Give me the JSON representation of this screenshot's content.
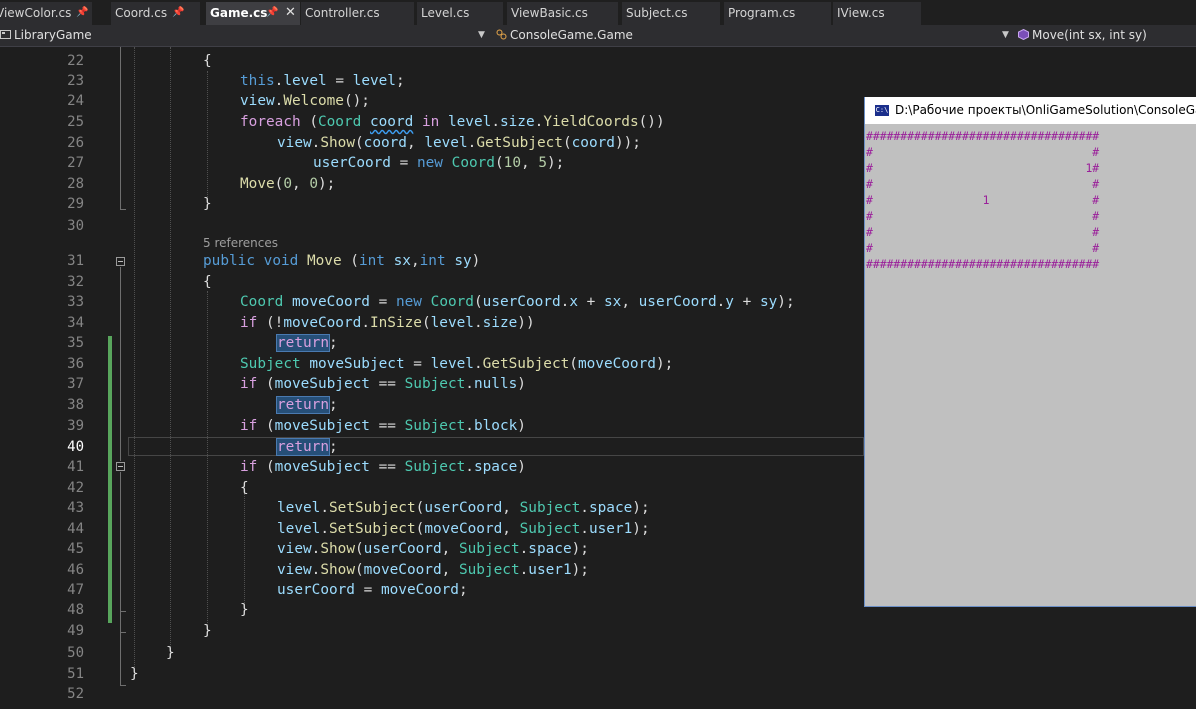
{
  "tabs": [
    {
      "label": "ViewColor.cs",
      "pinned": true,
      "active": false
    },
    {
      "label": "Coord.cs",
      "pinned": true,
      "active": false
    },
    {
      "label": "Game.cs",
      "pinned": true,
      "active": true
    },
    {
      "label": "Controller.cs",
      "pinned": false,
      "active": false
    },
    {
      "label": "Level.cs",
      "pinned": false,
      "active": false
    },
    {
      "label": "ViewBasic.cs",
      "pinned": false,
      "active": false
    },
    {
      "label": "Subject.cs",
      "pinned": false,
      "active": false
    },
    {
      "label": "Program.cs",
      "pinned": false,
      "active": false
    },
    {
      "label": "IView.cs",
      "pinned": false,
      "active": false
    }
  ],
  "icons": {
    "pin": "pin-icon",
    "close": "close-icon",
    "dropdown": "chevron-down-icon",
    "class": "class-icon",
    "method": "method-icon",
    "console": "console-app-icon"
  },
  "navbar": {
    "project": "LibraryGame",
    "type": "ConsoleGame.Game",
    "member": "Move(int sx, int sy)"
  },
  "editor": {
    "current_line": 40,
    "references_label": "5 references",
    "lines": [
      {
        "n": 22,
        "tokens": [
          [
            "pl",
            "{"
          ]
        ]
      },
      {
        "n": 23,
        "tokens": [
          [
            "kw",
            "this"
          ],
          [
            "pl",
            "."
          ],
          [
            "vr",
            "level"
          ],
          [
            "pl",
            " = "
          ],
          [
            "vr",
            "level"
          ],
          [
            "pl",
            ";"
          ]
        ]
      },
      {
        "n": 24,
        "tokens": [
          [
            "vr",
            "view"
          ],
          [
            "pl",
            "."
          ],
          [
            "fn",
            "Welcome"
          ],
          [
            "pl",
            "();"
          ]
        ]
      },
      {
        "n": 25,
        "tokens": [
          [
            "ctl",
            "foreach"
          ],
          [
            "pl",
            " ("
          ],
          [
            "ty",
            "Coord"
          ],
          [
            "pl",
            " "
          ],
          [
            "vr squig",
            "coord"
          ],
          [
            "pl",
            " "
          ],
          [
            "ctl",
            "in"
          ],
          [
            "pl",
            " "
          ],
          [
            "vr",
            "level"
          ],
          [
            "pl",
            "."
          ],
          [
            "vr",
            "size"
          ],
          [
            "pl",
            "."
          ],
          [
            "fn",
            "YieldCoords"
          ],
          [
            "pl",
            "())"
          ]
        ]
      },
      {
        "n": 26,
        "tokens": [
          [
            "vr",
            "view"
          ],
          [
            "pl",
            "."
          ],
          [
            "fn",
            "Show"
          ],
          [
            "pl",
            "("
          ],
          [
            "vr",
            "coord"
          ],
          [
            "pl",
            ", "
          ],
          [
            "vr",
            "level"
          ],
          [
            "pl",
            "."
          ],
          [
            "fn",
            "GetSubject"
          ],
          [
            "pl",
            "("
          ],
          [
            "vr",
            "coord"
          ],
          [
            "pl",
            "));"
          ]
        ]
      },
      {
        "n": 27,
        "tokens": [
          [
            "vr",
            "userCoord"
          ],
          [
            "pl",
            " = "
          ],
          [
            "kw",
            "new"
          ],
          [
            "pl",
            " "
          ],
          [
            "ty",
            "Coord"
          ],
          [
            "pl",
            "("
          ],
          [
            "nm",
            "10"
          ],
          [
            "pl",
            ", "
          ],
          [
            "nm",
            "5"
          ],
          [
            "pl",
            ");"
          ]
        ]
      },
      {
        "n": 28,
        "tokens": [
          [
            "fn",
            "Move"
          ],
          [
            "pl",
            "("
          ],
          [
            "nm",
            "0"
          ],
          [
            "pl",
            ", "
          ],
          [
            "nm",
            "0"
          ],
          [
            "pl",
            ");"
          ]
        ]
      },
      {
        "n": 29,
        "tokens": [
          [
            "pl",
            "}"
          ]
        ]
      },
      {
        "n": 30,
        "tokens": []
      },
      {
        "n": 31,
        "tokens": [
          [
            "kw",
            "public"
          ],
          [
            "pl",
            " "
          ],
          [
            "kw",
            "void"
          ],
          [
            "pl",
            " "
          ],
          [
            "fn",
            "Move"
          ],
          [
            "pl",
            " ("
          ],
          [
            "kw",
            "int"
          ],
          [
            "pl",
            " "
          ],
          [
            "vr",
            "sx"
          ],
          [
            "pl",
            ","
          ],
          [
            "kw",
            "int"
          ],
          [
            "pl",
            " "
          ],
          [
            "vr",
            "sy"
          ],
          [
            "pl",
            ")"
          ]
        ]
      },
      {
        "n": 32,
        "tokens": [
          [
            "pl",
            "{"
          ]
        ]
      },
      {
        "n": 33,
        "tokens": [
          [
            "ty",
            "Coord"
          ],
          [
            "pl",
            " "
          ],
          [
            "vr",
            "moveCoord"
          ],
          [
            "pl",
            " = "
          ],
          [
            "kw",
            "new"
          ],
          [
            "pl",
            " "
          ],
          [
            "ty",
            "Coord"
          ],
          [
            "pl",
            "("
          ],
          [
            "vr",
            "userCoord"
          ],
          [
            "pl",
            "."
          ],
          [
            "vr",
            "x"
          ],
          [
            "pl",
            " + "
          ],
          [
            "vr",
            "sx"
          ],
          [
            "pl",
            ", "
          ],
          [
            "vr",
            "userCoord"
          ],
          [
            "pl",
            "."
          ],
          [
            "vr",
            "y"
          ],
          [
            "pl",
            " + "
          ],
          [
            "vr",
            "sy"
          ],
          [
            "pl",
            ");"
          ]
        ]
      },
      {
        "n": 34,
        "tokens": [
          [
            "ctl",
            "if"
          ],
          [
            "pl",
            " (!"
          ],
          [
            "vr",
            "moveCoord"
          ],
          [
            "pl",
            "."
          ],
          [
            "fn",
            "InSize"
          ],
          [
            "pl",
            "("
          ],
          [
            "vr",
            "level"
          ],
          [
            "pl",
            "."
          ],
          [
            "vr",
            "size"
          ],
          [
            "pl",
            "))"
          ]
        ]
      },
      {
        "n": 35,
        "tokens": [
          [
            "ctl hl",
            "return"
          ],
          [
            "pl",
            ";"
          ]
        ]
      },
      {
        "n": 36,
        "tokens": [
          [
            "ty",
            "Subject"
          ],
          [
            "pl",
            " "
          ],
          [
            "vr",
            "moveSubject"
          ],
          [
            "pl",
            " = "
          ],
          [
            "vr",
            "level"
          ],
          [
            "pl",
            "."
          ],
          [
            "fn",
            "GetSubject"
          ],
          [
            "pl",
            "("
          ],
          [
            "vr",
            "moveCoord"
          ],
          [
            "pl",
            ");"
          ]
        ]
      },
      {
        "n": 37,
        "tokens": [
          [
            "ctl",
            "if"
          ],
          [
            "pl",
            " ("
          ],
          [
            "vr",
            "moveSubject"
          ],
          [
            "pl",
            " == "
          ],
          [
            "ty",
            "Subject"
          ],
          [
            "pl",
            "."
          ],
          [
            "vr",
            "nulls"
          ],
          [
            "pl",
            ")"
          ]
        ]
      },
      {
        "n": 38,
        "tokens": [
          [
            "ctl hl",
            "return"
          ],
          [
            "pl",
            ";"
          ]
        ]
      },
      {
        "n": 39,
        "tokens": [
          [
            "ctl",
            "if"
          ],
          [
            "pl",
            " ("
          ],
          [
            "vr",
            "moveSubject"
          ],
          [
            "pl",
            " == "
          ],
          [
            "ty",
            "Subject"
          ],
          [
            "pl",
            "."
          ],
          [
            "vr",
            "block"
          ],
          [
            "pl",
            ")"
          ]
        ]
      },
      {
        "n": 40,
        "tokens": [
          [
            "ctl hl",
            "return"
          ],
          [
            "pl",
            ";"
          ]
        ]
      },
      {
        "n": 41,
        "tokens": [
          [
            "ctl",
            "if"
          ],
          [
            "pl",
            " ("
          ],
          [
            "vr",
            "moveSubject"
          ],
          [
            "pl",
            " == "
          ],
          [
            "ty",
            "Subject"
          ],
          [
            "pl",
            "."
          ],
          [
            "vr",
            "space"
          ],
          [
            "pl",
            ")"
          ]
        ]
      },
      {
        "n": 42,
        "tokens": [
          [
            "pl",
            "{"
          ]
        ]
      },
      {
        "n": 43,
        "tokens": [
          [
            "vr",
            "level"
          ],
          [
            "pl",
            "."
          ],
          [
            "fn",
            "SetSubject"
          ],
          [
            "pl",
            "("
          ],
          [
            "vr",
            "userCoord"
          ],
          [
            "pl",
            ", "
          ],
          [
            "ty",
            "Subject"
          ],
          [
            "pl",
            "."
          ],
          [
            "vr",
            "space"
          ],
          [
            "pl",
            ");"
          ]
        ]
      },
      {
        "n": 44,
        "tokens": [
          [
            "vr",
            "level"
          ],
          [
            "pl",
            "."
          ],
          [
            "fn",
            "SetSubject"
          ],
          [
            "pl",
            "("
          ],
          [
            "vr",
            "moveCoord"
          ],
          [
            "pl",
            ", "
          ],
          [
            "ty",
            "Subject"
          ],
          [
            "pl",
            "."
          ],
          [
            "vr",
            "user1"
          ],
          [
            "pl",
            ");"
          ]
        ]
      },
      {
        "n": 45,
        "tokens": [
          [
            "vr",
            "view"
          ],
          [
            "pl",
            "."
          ],
          [
            "fn",
            "Show"
          ],
          [
            "pl",
            "("
          ],
          [
            "vr",
            "userCoord"
          ],
          [
            "pl",
            ", "
          ],
          [
            "ty",
            "Subject"
          ],
          [
            "pl",
            "."
          ],
          [
            "vr",
            "space"
          ],
          [
            "pl",
            ");"
          ]
        ]
      },
      {
        "n": 46,
        "tokens": [
          [
            "vr",
            "view"
          ],
          [
            "pl",
            "."
          ],
          [
            "fn",
            "Show"
          ],
          [
            "pl",
            "("
          ],
          [
            "vr",
            "moveCoord"
          ],
          [
            "pl",
            ", "
          ],
          [
            "ty",
            "Subject"
          ],
          [
            "pl",
            "."
          ],
          [
            "vr",
            "user1"
          ],
          [
            "pl",
            ");"
          ]
        ]
      },
      {
        "n": 47,
        "tokens": [
          [
            "vr",
            "userCoord"
          ],
          [
            "pl",
            " = "
          ],
          [
            "vr",
            "moveCoord"
          ],
          [
            "pl",
            ";"
          ]
        ]
      },
      {
        "n": 48,
        "tokens": [
          [
            "pl",
            "}"
          ]
        ]
      },
      {
        "n": 49,
        "tokens": [
          [
            "pl",
            "}"
          ]
        ]
      },
      {
        "n": 50,
        "tokens": [
          [
            "pl",
            "}"
          ]
        ]
      },
      {
        "n": 51,
        "tokens": [
          [
            "pl",
            "}"
          ]
        ]
      },
      {
        "n": 52,
        "tokens": []
      }
    ]
  },
  "console": {
    "title": "D:\\Рабочие проекты\\OnliGameSolution\\ConsoleGame\\b",
    "icon_text": "C:\\",
    "lines": [
      "##################################",
      "#                                #",
      "#                               1#",
      "#                                #",
      "#                1               #",
      "#                                #",
      "#                                #",
      "#                                #",
      "##################################"
    ]
  },
  "colors": {
    "editor_bg": "#1e1e1e",
    "keyword": "#569cd6",
    "control": "#d8a0df",
    "type": "#4ec9b0",
    "method": "#dcdcaa",
    "variable": "#9cdcfe",
    "number": "#b5cea8",
    "change_bar": "#58a55c",
    "console_bg": "#c0c0c0",
    "console_text": "#9a1f9a"
  }
}
